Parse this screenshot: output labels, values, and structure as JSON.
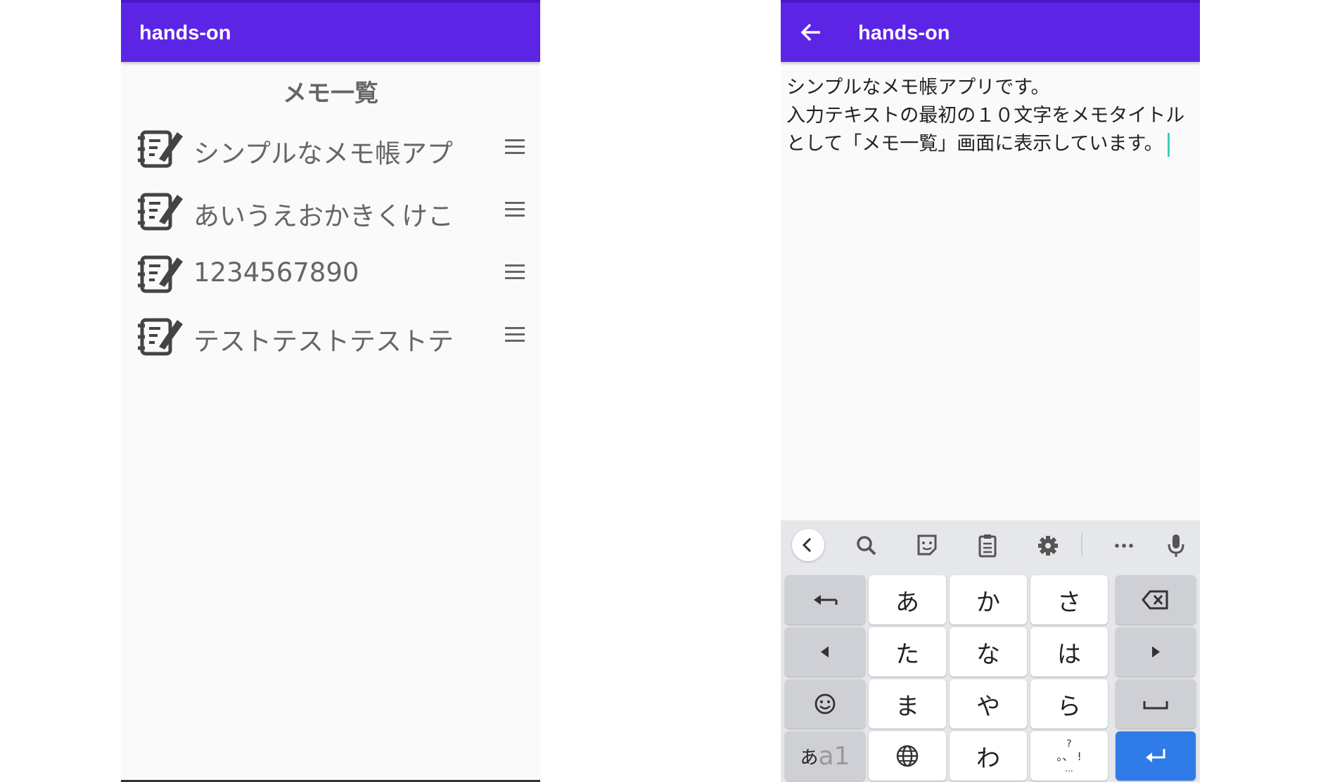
{
  "left_screen": {
    "app_title": "hands-on",
    "list_heading": "メモ一覧",
    "memos": [
      {
        "title": "シンプルなメモ帳アプ"
      },
      {
        "title": "あいうえおかきくけこ"
      },
      {
        "title": "1234567890"
      },
      {
        "title": "テストテストテストテ"
      }
    ]
  },
  "right_screen": {
    "app_title": "hands-on",
    "editor_lines": [
      "シンプルなメモ帳アプリです。",
      "入力テキストの最初の１０文字をメモタイトル",
      "として「メモ一覧」画面に表示しています。"
    ],
    "keyboard": {
      "toolbar_icons": [
        "chevron-left-icon",
        "search-icon",
        "sticker-icon",
        "clipboard-icon",
        "settings-icon",
        "more-icon",
        "microphone-icon"
      ],
      "keys": {
        "a": "あ",
        "ka": "か",
        "sa": "さ",
        "ta": "た",
        "na": "な",
        "ha": "は",
        "ma": "ま",
        "ya": "や",
        "ra": "ら",
        "wa": "わ",
        "mode_hira": "あ",
        "mode_alpha": "a1",
        "punct_top": "?",
        "punct_mid": "。、 !",
        "punct_bottom": "..."
      },
      "accent_color": "#2f7be8"
    }
  },
  "colors": {
    "app_bar": "#5c25e6",
    "background": "#fafafa",
    "cursor": "#3ccfbf"
  }
}
